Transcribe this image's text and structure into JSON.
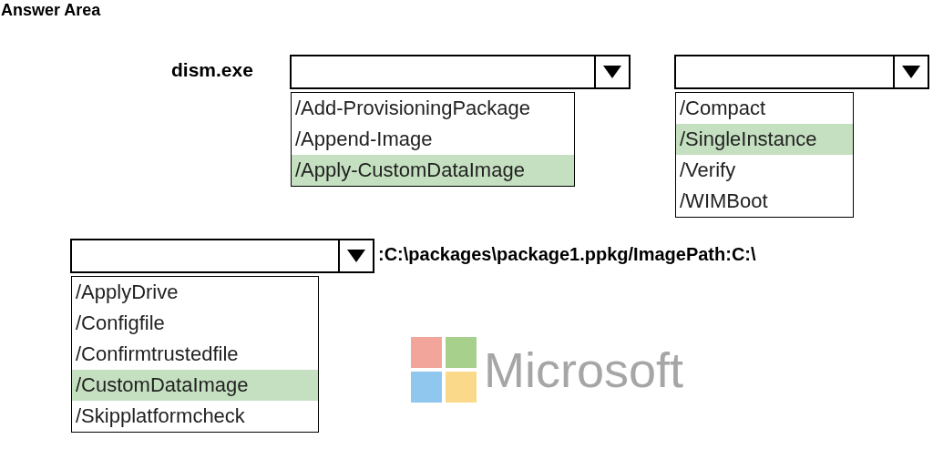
{
  "title": "Answer Area",
  "command": "dism.exe",
  "dropdowns": [
    {
      "options": [
        {
          "label": "/Add-ProvisioningPackage",
          "selected": false
        },
        {
          "label": "/Append-Image",
          "selected": false
        },
        {
          "label": "/Apply-CustomDataImage",
          "selected": true
        }
      ]
    },
    {
      "options": [
        {
          "label": "/Compact",
          "selected": false
        },
        {
          "label": "/SingleInstance",
          "selected": true
        },
        {
          "label": "/Verify",
          "selected": false
        },
        {
          "label": "/WIMBoot",
          "selected": false
        }
      ]
    },
    {
      "options": [
        {
          "label": "/ApplyDrive",
          "selected": false
        },
        {
          "label": "/Configfile",
          "selected": false
        },
        {
          "label": "/Confirmtrustedfile",
          "selected": false
        },
        {
          "label": "/CustomDataImage",
          "selected": true
        },
        {
          "label": "/Skipplatformcheck",
          "selected": false
        }
      ]
    }
  ],
  "argument": ":C:\\packages\\package1.ppkg/ImagePath:C:\\",
  "logo": {
    "text": "Microsoft"
  }
}
